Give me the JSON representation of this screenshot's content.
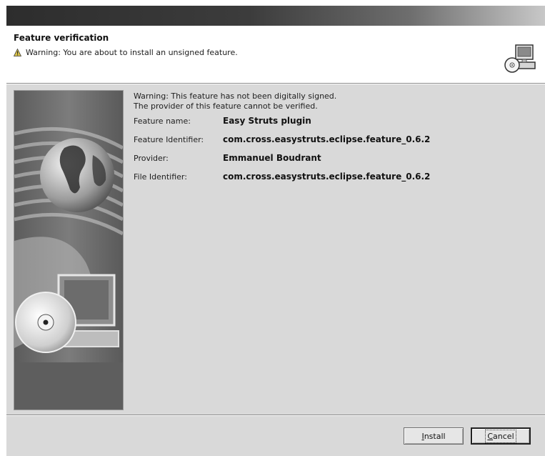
{
  "header": {
    "title": "Feature verification",
    "warning": "Warning: You are about to install an unsigned feature."
  },
  "message": {
    "line1": "Warning: This feature has not been digitally signed.",
    "line2": "The provider of this feature cannot be verified."
  },
  "details": {
    "feature_name_label": "Feature name:",
    "feature_name_value": "Easy Struts plugin",
    "feature_id_label": "Feature Identifier:",
    "feature_id_value": "com.cross.easystruts.eclipse.feature_0.6.2",
    "provider_label": "Provider:",
    "provider_value": "Emmanuel Boudrant",
    "file_id_label": "File Identifier:",
    "file_id_value": "com.cross.easystruts.eclipse.feature_0.6.2"
  },
  "buttons": {
    "install_mnemonic": "I",
    "install_rest": "nstall",
    "cancel_mnemonic": "C",
    "cancel_rest": "ancel"
  },
  "icons": {
    "warning": "warning-triangle-icon",
    "wizard": "computer-cd-icon",
    "banner": "globe-cd-computer-banner"
  }
}
